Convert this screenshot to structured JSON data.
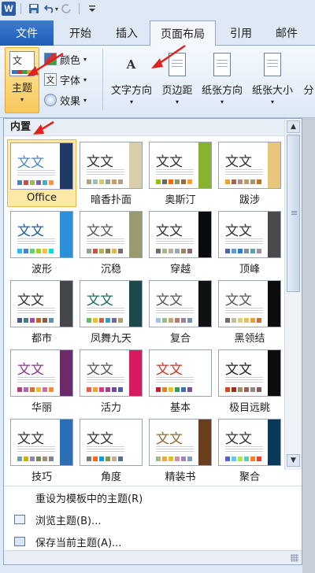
{
  "app": {
    "logo": "W"
  },
  "qat": {
    "buttons": [
      "save-icon",
      "undo-icon",
      "redo-icon",
      "customize-icon"
    ]
  },
  "tabs": {
    "file": "文件",
    "items": [
      "开始",
      "插入",
      "页面布局",
      "引用",
      "邮件"
    ],
    "active": "页面布局"
  },
  "ribbon": {
    "themes_label": "主题",
    "colors_label": "颜色",
    "fonts_label": "字体",
    "effects_label": "效果",
    "text_direction": "文字方向",
    "margins": "页边距",
    "orientation": "纸张方向",
    "size": "纸张大小",
    "columns_partial": "分",
    "text_direction_icon_text": "A",
    "fonts_icon_text": "文"
  },
  "gallery": {
    "section_title": "内置",
    "themes": [
      {
        "name": "Office",
        "word": "文文",
        "accent": "#1f3864",
        "text": "#4a86c5",
        "swatches": [
          "#4f81bd",
          "#c0504d",
          "#9bbb59",
          "#8064a2",
          "#4bacc6",
          "#f79646"
        ],
        "selected": true
      },
      {
        "name": "暗香扑面",
        "word": "文文",
        "accent": "#d8ceaa",
        "text": "#333333",
        "swatches": [
          "#a9a57c",
          "#9cbebd",
          "#d2cb6c",
          "#95a39d",
          "#c89f5d",
          "#b1a089"
        ]
      },
      {
        "name": "奥斯汀",
        "word": "文文",
        "accent": "#86b22f",
        "text": "#333333",
        "swatches": [
          "#94c600",
          "#71685a",
          "#ff6700",
          "#909465",
          "#956b43",
          "#fea022"
        ]
      },
      {
        "name": "跋涉",
        "word": "文文",
        "accent": "#e8c77a",
        "text": "#333333",
        "swatches": [
          "#f0a22e",
          "#a5644e",
          "#b58b80",
          "#c3986d",
          "#a19574",
          "#c17529"
        ]
      },
      {
        "name": "波形",
        "word": "文文",
        "accent": "#2c8fd8",
        "text": "#1f5a96",
        "swatches": [
          "#31b6fd",
          "#4584d3",
          "#5bd078",
          "#a5d028",
          "#f5c040",
          "#05e0db"
        ]
      },
      {
        "name": "沉稳",
        "word": "文文",
        "accent": "#9a9a6e",
        "text": "#555555",
        "swatches": [
          "#93a299",
          "#cf543f",
          "#b5ae53",
          "#848058",
          "#e8b54d",
          "#786c71"
        ]
      },
      {
        "name": "穿越",
        "word": "文文",
        "accent": "#0a0a0a",
        "text": "#333333",
        "swatches": [
          "#6f6f74",
          "#a7b789",
          "#beae98",
          "#92a9b9",
          "#9c8265",
          "#8d6974"
        ]
      },
      {
        "name": "顶峰",
        "word": "文文",
        "accent": "#4a4a4a",
        "text": "#333333",
        "swatches": [
          "#4a66ac",
          "#629dd1",
          "#297fd5",
          "#7f8fa9",
          "#5aa2ae",
          "#9d90a0"
        ]
      },
      {
        "name": "都市",
        "word": "文文",
        "accent": "#46464a",
        "text": "#333333",
        "swatches": [
          "#53548a",
          "#438086",
          "#a04da3",
          "#c4652d",
          "#8b5d3d",
          "#5c92b5"
        ]
      },
      {
        "name": "凤舞九天",
        "word": "文文",
        "accent": "#1c4a4a",
        "text": "#1e6a5a",
        "swatches": [
          "#6bb76d",
          "#e8c231",
          "#c3644d",
          "#3a9ac8",
          "#6c6c94",
          "#b3a06e"
        ]
      },
      {
        "name": "复合",
        "word": "文文",
        "accent": "#111111",
        "text": "#555555",
        "swatches": [
          "#a0c4d9",
          "#98bb8e",
          "#c6a774",
          "#b77c68",
          "#9b7f9b",
          "#7694b1"
        ]
      },
      {
        "name": "黑领结",
        "word": "文文",
        "accent": "#0c0c0c",
        "text": "#555555",
        "swatches": [
          "#6f6f6f",
          "#bfbfa5",
          "#dcd084",
          "#e7bf5f",
          "#e9a039",
          "#cf7133"
        ]
      },
      {
        "name": "华丽",
        "word": "文文",
        "accent": "#6d2a6a",
        "text": "#8a3a8a",
        "swatches": [
          "#b83d68",
          "#ac66bb",
          "#de6c36",
          "#f9b639",
          "#cf6da4",
          "#fa8d3d"
        ]
      },
      {
        "name": "活力",
        "word": "文文",
        "accent": "#d81b60",
        "text": "#555555",
        "swatches": [
          "#ef5c49",
          "#f3a62c",
          "#e0387d",
          "#a43e8e",
          "#6e4ba1",
          "#4a5fa8"
        ]
      },
      {
        "name": "基本",
        "word": "文文",
        "accent": "#ffffff",
        "text": "#c0392b",
        "swatches": [
          "#c81c36",
          "#e0852c",
          "#e8c433",
          "#3b9a57",
          "#3a72b6",
          "#7a4ea0"
        ]
      },
      {
        "name": "极目远眺",
        "word": "文文",
        "accent": "#0d0d0d",
        "text": "#222222",
        "swatches": [
          "#d34817",
          "#9b2d1f",
          "#a28e6a",
          "#956251",
          "#918485",
          "#855d5d"
        ]
      },
      {
        "name": "技巧",
        "word": "文文",
        "accent": "#2a6fb5",
        "text": "#333333",
        "swatches": [
          "#6ea0b0",
          "#ccaf0a",
          "#8d89a4",
          "#748560",
          "#9e9273",
          "#7e848d"
        ]
      },
      {
        "name": "角度",
        "word": "文文",
        "accent": "#ffffff",
        "text": "#333333",
        "swatches": [
          "#797b7e",
          "#f96a1b",
          "#08a1d9",
          "#7c984a",
          "#c2ad8d",
          "#506e94"
        ]
      },
      {
        "name": "精装书",
        "word": "文文",
        "accent": "#6b3e1e",
        "text": "#8a6a3a",
        "swatches": [
          "#a5b592",
          "#f3a447",
          "#e7bc29",
          "#d092a7",
          "#9c85c0",
          "#809ec2"
        ]
      },
      {
        "name": "聚合",
        "word": "文文",
        "accent": "#0a3a5a",
        "text": "#333333",
        "swatches": [
          "#4e67c8",
          "#5eccf3",
          "#a7ea52",
          "#5dceaf",
          "#ff8021",
          "#f14124"
        ]
      }
    ]
  },
  "menu": {
    "reset": "重设为模板中的主题(R)",
    "browse": "浏览主题(B)...",
    "save": "保存当前主题(A)..."
  }
}
